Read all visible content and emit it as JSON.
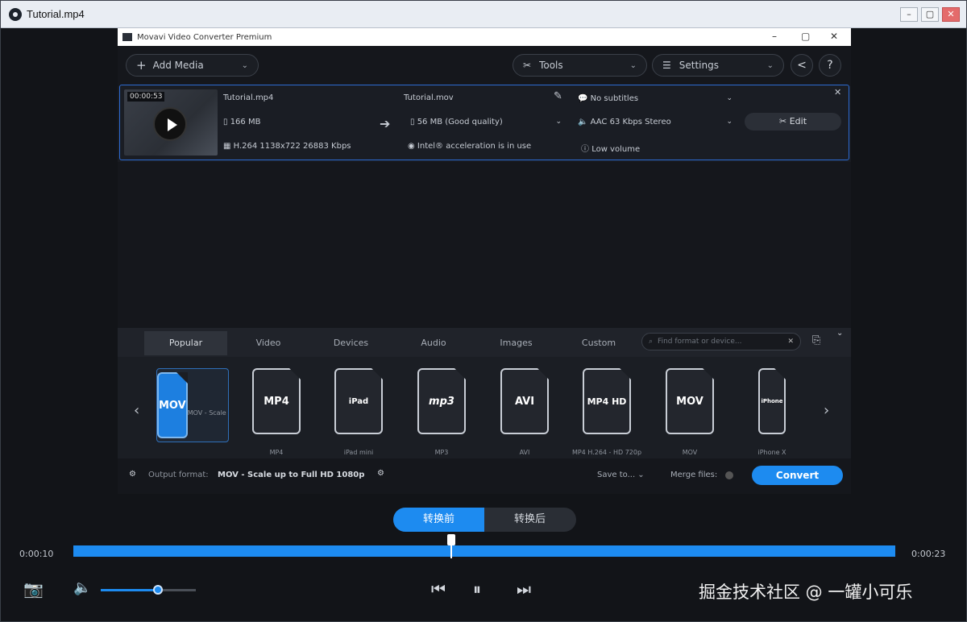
{
  "player": {
    "title": "Tutorial.mp4",
    "time_current": "0:00:10",
    "time_total": "0:00:23",
    "progress": 0.46,
    "volume": 0.6,
    "switch": [
      "转换前",
      "转换后"
    ],
    "caption": "掘金技术社区 @ 一罐小可乐"
  },
  "app": {
    "title": "Movavi Video Converter Premium",
    "add_media": "Add Media",
    "tools": "Tools",
    "settings": "Settings",
    "file": {
      "duration": "00:00:53",
      "src_name": "Tutorial.mp4",
      "src_size": "166 MB",
      "src_codec": "H.264 1138x722 26883 Kbps",
      "dst_name": "Tutorial.mov",
      "dst_size": "56 MB (Good quality)",
      "acceleration": "Intel® acceleration is in use",
      "subtitles": "No subtitles",
      "audio": "AAC 63 Kbps Stereo",
      "volume_warn": "Low volume",
      "edit": "Edit"
    },
    "tabs": [
      "Popular",
      "Video",
      "Devices",
      "Audio",
      "Images",
      "Custom"
    ],
    "search_placeholder": "Find format or device...",
    "formats": [
      {
        "icon": "MOV",
        "label": "MOV - Scale up to Full..."
      },
      {
        "icon": "MP4",
        "label": "MP4"
      },
      {
        "icon": "iPad",
        "label": "iPad mini"
      },
      {
        "icon": "mp3",
        "label": "MP3"
      },
      {
        "icon": "AVI",
        "label": "AVI"
      },
      {
        "icon": "MP4 HD",
        "label": "MP4 H.264 - HD 720p"
      },
      {
        "icon": "MOV",
        "label": "MOV"
      },
      {
        "icon": "iPhone",
        "label": "iPhone X"
      }
    ],
    "output_label": "Output format:",
    "output_value": "MOV - Scale up to Full HD 1080p",
    "save_to": "Save to...",
    "merge_files": "Merge files:",
    "convert": "Convert"
  }
}
